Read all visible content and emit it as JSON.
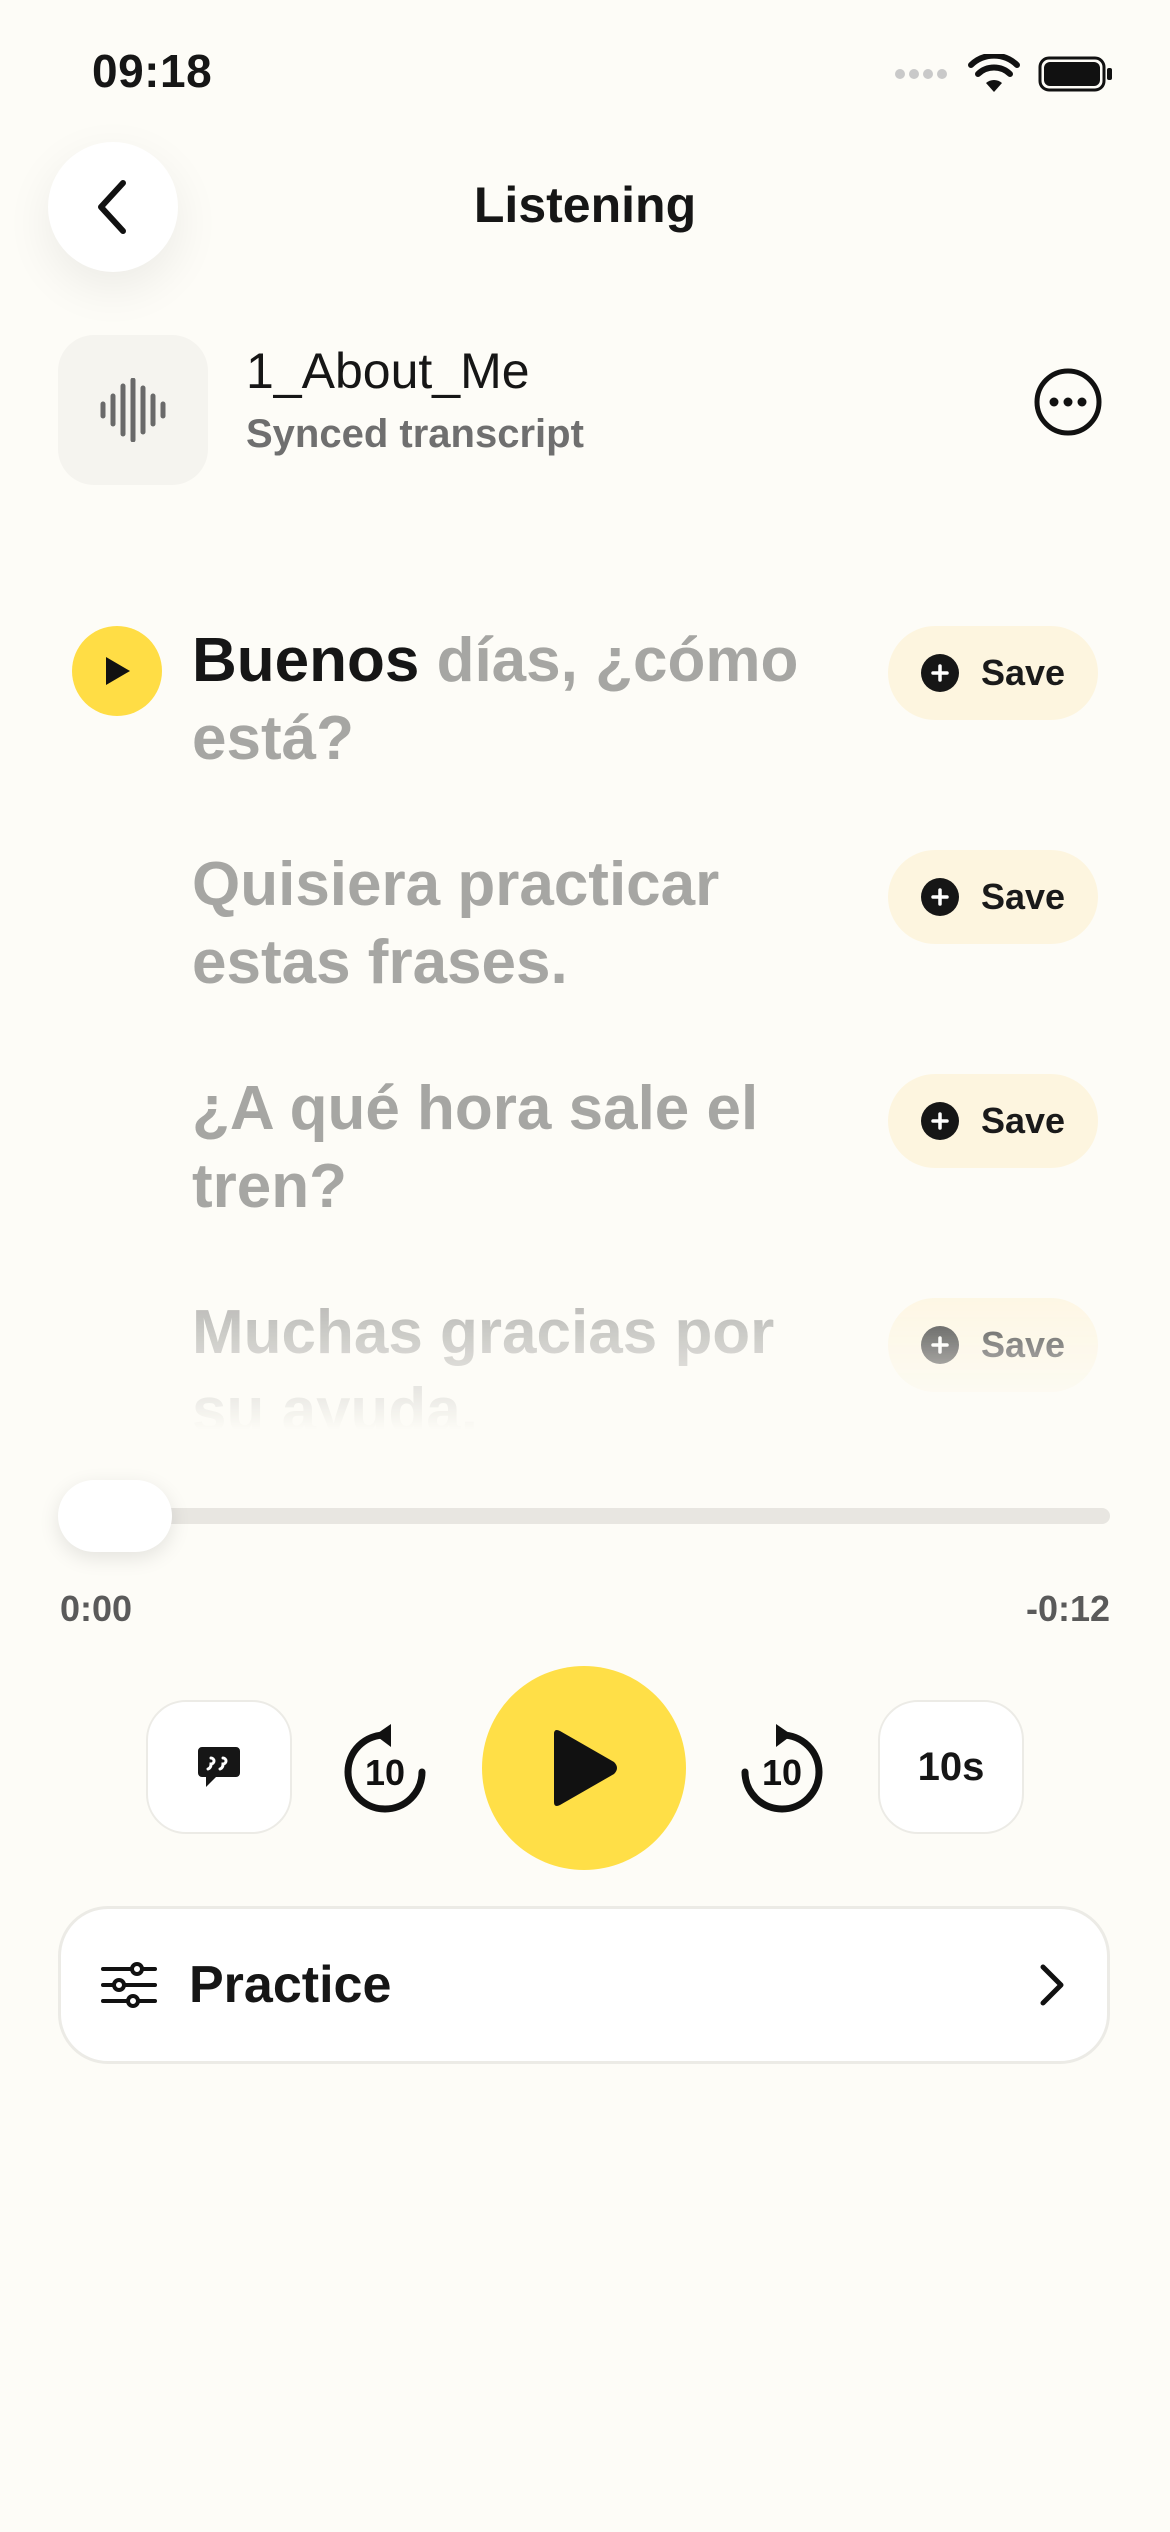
{
  "status_bar": {
    "time": "09:18"
  },
  "header": {
    "title": "Listening"
  },
  "track": {
    "title": "1_About_Me",
    "subtitle": "Synced transcript"
  },
  "transcript": {
    "lines": [
      {
        "active_word": "Buenos",
        "rest": " días, ¿cómo está?",
        "save_label": "Save"
      },
      {
        "text": "Quisiera practicar estas frases.",
        "save_label": "Save"
      },
      {
        "text": "¿A qué hora sale el tren?",
        "save_label": "Save"
      },
      {
        "text": "Muchas gracias por su ayuda.",
        "save_label": "Save"
      }
    ]
  },
  "player": {
    "elapsed": "0:00",
    "remaining": "-0:12",
    "progress_fraction": 0,
    "skip_seconds": "10",
    "speed_label": "10s"
  },
  "practice": {
    "label": "Practice"
  },
  "colors": {
    "accent": "#ffdd45",
    "background": "#fdfcf7",
    "muted_text": "#a6a6a3"
  },
  "icons": [
    "back-chevron-icon",
    "waveform-icon",
    "more-icon",
    "play-icon",
    "plus-icon",
    "quote-bubble-icon",
    "rewind-10-icon",
    "forward-10-icon",
    "sliders-icon",
    "chevron-right-icon"
  ]
}
